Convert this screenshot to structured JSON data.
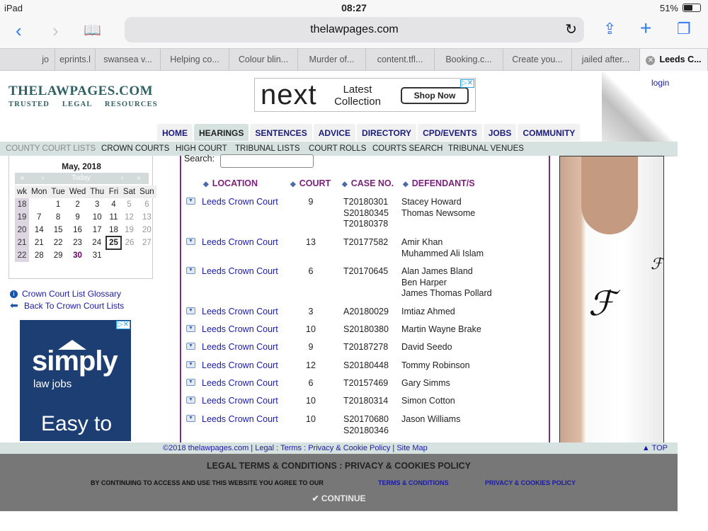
{
  "status": {
    "device": "iPad",
    "time": "08:27",
    "battery": "51%"
  },
  "browser": {
    "url": "thelawpages.com",
    "tabs": [
      {
        "label": "jo"
      },
      {
        "label": "eprints.l"
      },
      {
        "label": "swansea v..."
      },
      {
        "label": "Helping co..."
      },
      {
        "label": "Colour blin..."
      },
      {
        "label": "Murder of..."
      },
      {
        "label": "content.tfl..."
      },
      {
        "label": "Booking.c..."
      },
      {
        "label": "Create you..."
      },
      {
        "label": "jailed after..."
      },
      {
        "label": "Leeds C..."
      }
    ]
  },
  "site": {
    "logo_title": "THELAWPAGES.COM",
    "logo_tagline": "TRUSTED LEGAL RESOURCES",
    "login": "login",
    "ad_top": {
      "brand": "next",
      "text": "Latest Collection",
      "button": "Shop Now"
    },
    "nav": [
      "HOME",
      "HEARINGS",
      "SENTENCES",
      "ADVICE",
      "DIRECTORY",
      "CPD/EVENTS",
      "JOBS",
      "COMMUNITY"
    ],
    "subnav": [
      "COUNTY COURT LISTS",
      "CROWN COURTS",
      "HIGH COURT",
      "TRIBUNAL LISTS",
      "COURT ROLLS",
      "COURTS SEARCH",
      "TRIBUNAL VENUES"
    ]
  },
  "calendar": {
    "title": "May, 2018",
    "nav": {
      "prev2": "«",
      "prev": "‹",
      "today": "Today",
      "next": "›",
      "next2": "»"
    },
    "headers": [
      "wk",
      "Mon",
      "Tue",
      "Wed",
      "Thu",
      "Fri",
      "Sat",
      "Sun"
    ],
    "weeks": [
      [
        "18",
        "",
        "1",
        "2",
        "3",
        "4",
        "5",
        "6"
      ],
      [
        "19",
        "7",
        "8",
        "9",
        "10",
        "11",
        "12",
        "13"
      ],
      [
        "20",
        "14",
        "15",
        "16",
        "17",
        "18",
        "19",
        "20"
      ],
      [
        "21",
        "21",
        "22",
        "23",
        "24",
        "25",
        "26",
        "27"
      ],
      [
        "22",
        "28",
        "29",
        "30",
        "31",
        "",
        "",
        ""
      ]
    ]
  },
  "sidebar_links": {
    "glossary": "Crown Court List Glossary",
    "back": "Back To Crown Court Lists"
  },
  "ad_left": {
    "brand": "simply",
    "sub": "law jobs",
    "tagline": "Easy to"
  },
  "search": {
    "label": "Search:",
    "value": ""
  },
  "table": {
    "headers": {
      "location": "LOCATION",
      "court": "COURT",
      "case": "CASE NO.",
      "defendants": "DEFENDANT/S"
    },
    "rows": [
      {
        "location": "Leeds Crown Court",
        "court": "9",
        "cases": [
          "T20180301",
          "S20180345",
          "T20180378"
        ],
        "defendants": [
          "Stacey Howard",
          "Thomas Newsome"
        ]
      },
      {
        "location": "Leeds Crown Court",
        "court": "13",
        "cases": [
          "T20177582"
        ],
        "defendants": [
          "Amir Khan",
          "Muhammed Ali Islam"
        ]
      },
      {
        "location": "Leeds Crown Court",
        "court": "6",
        "cases": [
          "T20170645"
        ],
        "defendants": [
          "Alan James Bland",
          "Ben Harper",
          "James Thomas Pollard"
        ]
      },
      {
        "location": "Leeds Crown Court",
        "court": "3",
        "cases": [
          "A20180029"
        ],
        "defendants": [
          "Imtiaz Ahmed"
        ]
      },
      {
        "location": "Leeds Crown Court",
        "court": "10",
        "cases": [
          "S20180380"
        ],
        "defendants": [
          "Martin Wayne Brake"
        ]
      },
      {
        "location": "Leeds Crown Court",
        "court": "9",
        "cases": [
          "T20187278"
        ],
        "defendants": [
          "David Seedo"
        ]
      },
      {
        "location": "Leeds Crown Court",
        "court": "12",
        "cases": [
          "S20180448"
        ],
        "defendants": [
          "Tommy Robinson"
        ]
      },
      {
        "location": "Leeds Crown Court",
        "court": "6",
        "cases": [
          "T20157469"
        ],
        "defendants": [
          "Gary Simms"
        ]
      },
      {
        "location": "Leeds Crown Court",
        "court": "10",
        "cases": [
          "T20180314"
        ],
        "defendants": [
          "Simon Cotton"
        ]
      },
      {
        "location": "Leeds Crown Court",
        "court": "10",
        "cases": [
          "S20170680",
          "S20180346"
        ],
        "defendants": [
          "Jason Williams"
        ]
      }
    ]
  },
  "footer": {
    "copyright": "©2018 thelawpages.com | Legal : Terms : Privacy & Cookie Policy | Site Map",
    "top": "▲ TOP"
  },
  "cookie": {
    "heading": "LEGAL TERMS & CONDITIONS : PRIVACY & COOKIES POLICY",
    "body": "BY CONTINUING TO ACCESS AND USE THIS WEBSITE YOU AGREE TO OUR",
    "terms_link": "TERMS & CONDITIONS",
    "privacy_link": "PRIVACY & COOKIES POLICY",
    "continue": "✔ CONTINUE"
  },
  "colors": {
    "accent": "#2f7bf5",
    "nav_text": "#1b1b7a",
    "table_border": "#7a2d78",
    "link": "#1a1aa6",
    "subnav_bg": "#d6e2e0"
  }
}
